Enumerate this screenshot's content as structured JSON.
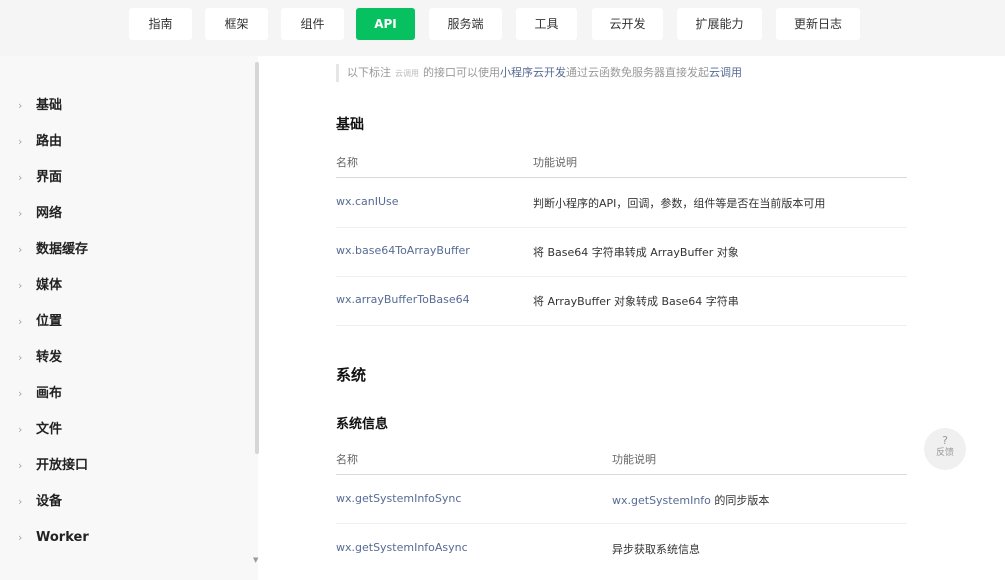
{
  "tabs": [
    {
      "label": "指南",
      "active": false
    },
    {
      "label": "框架",
      "active": false
    },
    {
      "label": "组件",
      "active": false
    },
    {
      "label": "API",
      "active": true
    },
    {
      "label": "服务端",
      "active": false
    },
    {
      "label": "工具",
      "active": false
    },
    {
      "label": "云开发",
      "active": false
    },
    {
      "label": "扩展能力",
      "active": false
    },
    {
      "label": "更新日志",
      "active": false
    }
  ],
  "sidebar": {
    "items": [
      {
        "label": "基础"
      },
      {
        "label": "路由"
      },
      {
        "label": "界面"
      },
      {
        "label": "网络"
      },
      {
        "label": "数据缓存"
      },
      {
        "label": "媒体"
      },
      {
        "label": "位置"
      },
      {
        "label": "转发"
      },
      {
        "label": "画布"
      },
      {
        "label": "文件"
      },
      {
        "label": "开放接口"
      },
      {
        "label": "设备"
      },
      {
        "label": "Worker"
      }
    ]
  },
  "note": {
    "prefix": "以下标注",
    "tag": "云调用",
    "middle": "的接口可以使用",
    "link1": "小程序云开发",
    "middle2": "通过云函数免服务器直接发起",
    "link2": "云调用"
  },
  "basics": {
    "heading": "基础",
    "col_name": "名称",
    "col_desc": "功能说明",
    "rows": [
      {
        "name": "wx.canIUse",
        "desc": "判断小程序的API，回调，参数，组件等是否在当前版本可用"
      },
      {
        "name": "wx.base64ToArrayBuffer",
        "desc": "将 Base64 字符串转成 ArrayBuffer 对象"
      },
      {
        "name": "wx.arrayBufferToBase64",
        "desc": "将 ArrayBuffer 对象转成 Base64 字符串"
      }
    ]
  },
  "system": {
    "heading": "系统",
    "subheading": "系统信息",
    "col_name": "名称",
    "col_desc": "功能说明",
    "rows": [
      {
        "name": "wx.getSystemInfoSync",
        "desc_link": "wx.getSystemInfo",
        "desc": " 的同步版本"
      },
      {
        "name": "wx.getSystemInfoAsync",
        "desc_link": "",
        "desc": "异步获取系统信息"
      }
    ]
  },
  "feedback": {
    "icon": "?",
    "label": "反馈"
  },
  "colors": {
    "accent": "#07c160",
    "link": "#576b95"
  }
}
